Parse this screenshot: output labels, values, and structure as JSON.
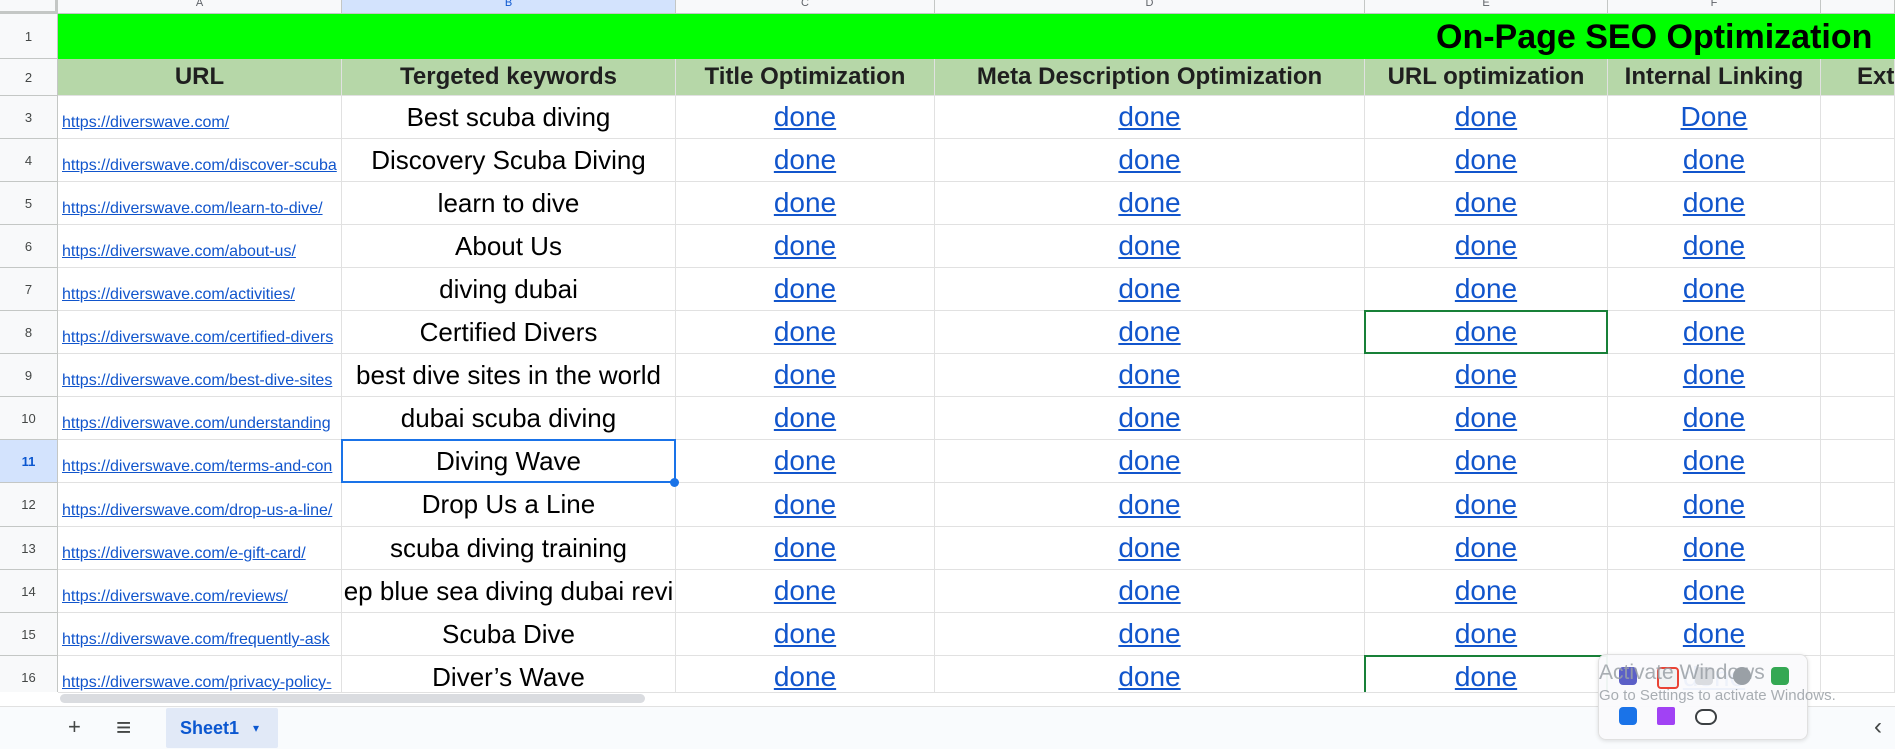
{
  "sheet": {
    "column_letters": [
      "A",
      "B",
      "C",
      "D",
      "E",
      "F"
    ],
    "row_numbers": [
      "1",
      "2",
      "3",
      "4",
      "5",
      "6",
      "7",
      "8",
      "9",
      "10",
      "11",
      "12",
      "13",
      "14",
      "15",
      "16"
    ],
    "banner_title": "On-Page SEO Optimization",
    "headers": [
      "URL",
      "Tergeted keywords",
      "Title Optimization",
      "Meta Description Optimization",
      "URL optimization",
      "Internal Linking",
      "Ext"
    ],
    "rows": [
      {
        "url": "https://diverswave.com/",
        "kw": "Best scuba diving",
        "c": "done",
        "d": "done",
        "e": "done",
        "f": "Done"
      },
      {
        "url": "https://diverswave.com/discover-scuba",
        "kw": "Discovery Scuba Diving",
        "c": "done",
        "d": "done",
        "e": "done",
        "f": "done"
      },
      {
        "url": "https://diverswave.com/learn-to-dive/",
        "kw": "learn to dive",
        "c": "done",
        "d": "done",
        "e": "done",
        "f": "done"
      },
      {
        "url": "https://diverswave.com/about-us/",
        "kw": "About Us",
        "c": "done",
        "d": "done",
        "e": "done",
        "f": "done"
      },
      {
        "url": "https://diverswave.com/activities/",
        "kw": "diving dubai",
        "c": "done",
        "d": "done",
        "e": "done",
        "f": "done"
      },
      {
        "url": "https://diverswave.com/certified-divers",
        "kw": "Certified Divers",
        "c": "done",
        "d": "done",
        "e": "done",
        "f": "done"
      },
      {
        "url": "https://diverswave.com/best-dive-sites",
        "kw": "best dive sites in the world",
        "c": "done",
        "d": "done",
        "e": "done",
        "f": "done"
      },
      {
        "url": "https://diverswave.com/understanding",
        "kw": "dubai scuba diving",
        "c": "done",
        "d": "done",
        "e": "done",
        "f": "done"
      },
      {
        "url": "https://diverswave.com/terms-and-con",
        "kw": "Diving Wave",
        "c": "done",
        "d": "done",
        "e": "done",
        "f": "done"
      },
      {
        "url": "https://diverswave.com/drop-us-a-line/",
        "kw": "Drop Us a Line",
        "c": "done",
        "d": "done",
        "e": "done",
        "f": "done"
      },
      {
        "url": "https://diverswave.com/e-gift-card/",
        "kw": "scuba diving training",
        "c": "done",
        "d": "done",
        "e": "done",
        "f": "done"
      },
      {
        "url": "https://diverswave.com/reviews/",
        "kw": "ep blue sea diving dubai revi",
        "c": "done",
        "d": "done",
        "e": "done",
        "f": "done"
      },
      {
        "url": "https://diverswave.com/frequently-ask",
        "kw": "Scuba Dive",
        "c": "done",
        "d": "done",
        "e": "done",
        "f": "done"
      },
      {
        "url": "https://diverswave.com/privacy-policy-",
        "kw": "Diver’s Wave",
        "c": "done",
        "d": "done",
        "e": "done",
        "f": "done"
      }
    ]
  },
  "footer": {
    "add_sheet": "+",
    "all_sheets": "≡",
    "sheet_tab_label": "Sheet1",
    "sheet_tab_caret": "▾",
    "explore_chevron": "‹"
  },
  "overlay": {
    "watermark_line1": "Activate Windows",
    "watermark_line2": "Go to Settings to activate Windows."
  },
  "colors": {
    "banner": "#00ff00",
    "header_fill": "#b6d7a8",
    "link": "#1155cc",
    "selection": "#1a73e8",
    "active_border": "#188038"
  }
}
